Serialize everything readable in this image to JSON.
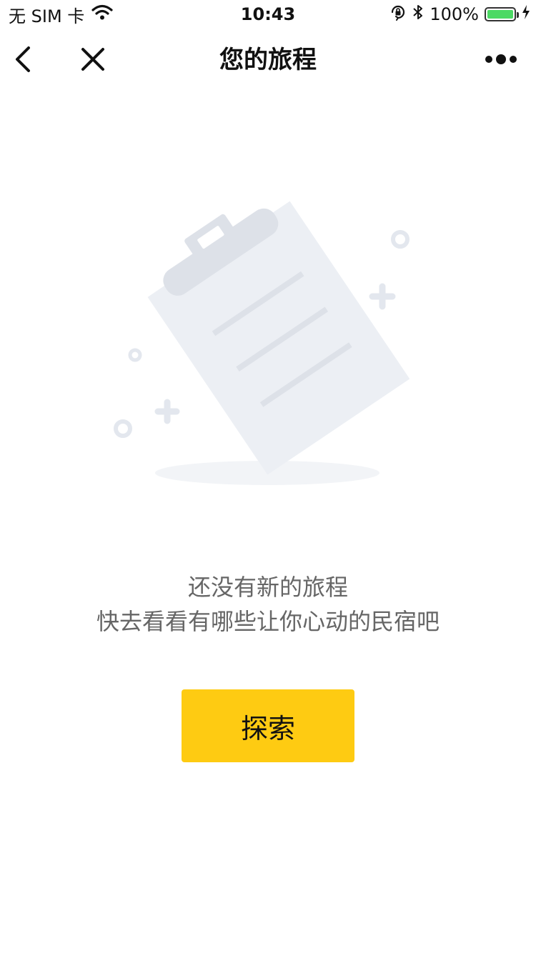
{
  "status_bar": {
    "carrier": "无 SIM 卡",
    "time": "10:43",
    "battery_percent": "100%",
    "battery_level": 1.0,
    "icons": {
      "wifi": "wifi-icon",
      "rotation_lock": "rotation-lock-icon",
      "bluetooth": "bluetooth-icon",
      "battery": "battery-icon",
      "charging": "charging-bolt-icon"
    }
  },
  "nav": {
    "title": "您的旅程",
    "icons": {
      "back": "chevron-left-icon",
      "close": "close-icon",
      "more": "more-dots-icon"
    }
  },
  "empty_state": {
    "illustration": "clipboard-illustration",
    "line1": "还没有新的旅程",
    "line2": "快去看看有哪些让你心动的民宿吧"
  },
  "actions": {
    "explore_label": "探索"
  },
  "colors": {
    "accent": "#fecb12",
    "text_primary": "#111111",
    "text_secondary": "#666666",
    "illustration_light": "#eceff4",
    "illustration_dark": "#dde1e8",
    "battery_green": "#4cd964"
  }
}
